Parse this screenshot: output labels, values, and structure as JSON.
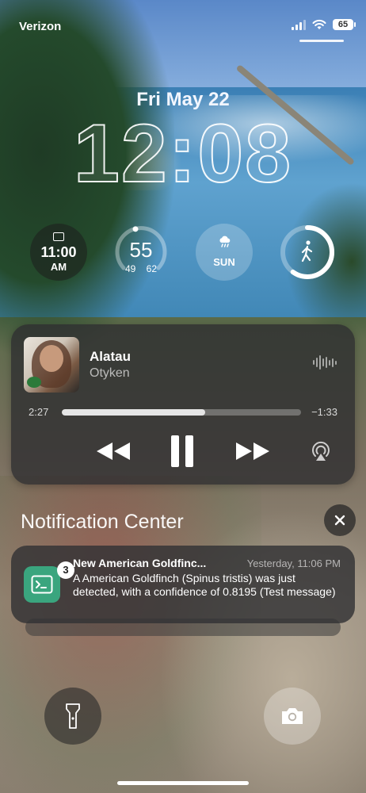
{
  "status_bar": {
    "carrier": "Verizon",
    "battery": "65",
    "icons": [
      "signal-icon",
      "wifi-icon",
      "battery-icon"
    ]
  },
  "lock_screen": {
    "date": "Fri May 22",
    "time": "12:08"
  },
  "widgets": {
    "clock": {
      "time": "11:00",
      "ampm": "AM",
      "icon": "calendar-icon"
    },
    "temperature": {
      "current": "55",
      "low": "49",
      "high": "62",
      "gauge_fraction": 0.45
    },
    "weather": {
      "label": "SUN",
      "icon": "rain-cloud-icon"
    },
    "activity": {
      "icon": "walking-icon",
      "ring_fraction": 0.6
    }
  },
  "now_playing": {
    "song": "Alatau",
    "artist": "Otyken",
    "elapsed": "2:27",
    "remaining": "−1:33",
    "progress_fraction": 0.6,
    "controls": [
      "rewind-icon",
      "pause-icon",
      "fast-forward-icon",
      "airplay-icon"
    ]
  },
  "notification_center": {
    "title": "Notification Center",
    "notification": {
      "title": "New American Goldfinc...",
      "time": "Yesterday, 11:06 PM",
      "body": "A American Goldfinch (Spinus tristis) was just detected, with a confidence of 0.8195 (Test message)",
      "badge_count": "3",
      "app_icon": "terminal-icon",
      "app_color": "#3aa57e"
    }
  },
  "quick_actions": {
    "left": "flashlight-icon",
    "right": "camera-icon"
  }
}
